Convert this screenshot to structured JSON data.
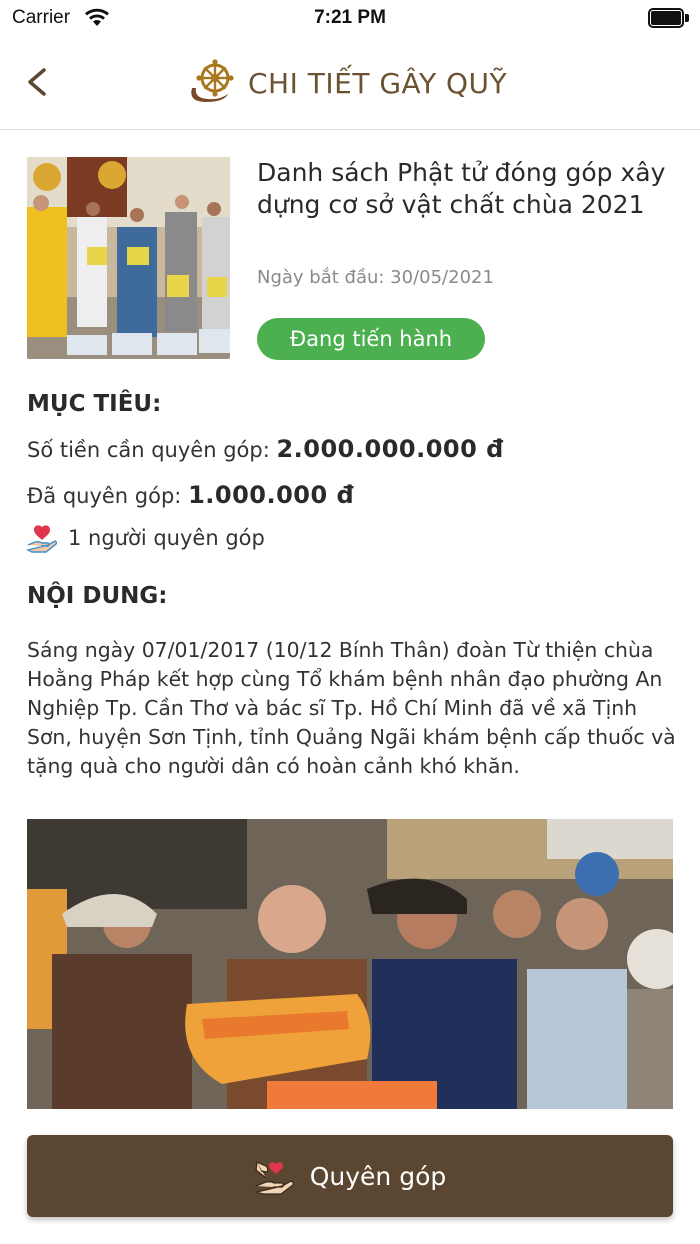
{
  "status_bar": {
    "carrier": "Carrier",
    "time": "7:21 PM"
  },
  "nav": {
    "title": "CHI TIẾT GÂY QUỸ",
    "back_icon": "chevron-left-icon",
    "logo_icon": "dharma-wheel-icon"
  },
  "campaign": {
    "title": "Danh sách Phật tử đóng góp xây dựng cơ sở vật chất chùa 2021",
    "start_date": "Ngày bắt đầu: 30/05/2021",
    "status": "Đang tiến hành"
  },
  "goal": {
    "heading": "MỤC TIÊU:",
    "target_label": "Số tiền cần quyên góp: ",
    "target_value": "2.000.000.000 đ",
    "raised_label": "Đã quyên góp: ",
    "raised_value": "1.000.000 đ",
    "donors": "1 người quyên góp"
  },
  "content": {
    "heading": "NỘI DUNG:",
    "text": "Sáng ngày 07/01/2017 (10/12 Bính Thân) đoàn Từ thiện chùa Hoằng Pháp kết hợp cùng Tổ khám bệnh nhân đạo phường An Nghiệp Tp. Cần Thơ và bác sĩ Tp. Hồ Chí Minh đã về xã Tịnh Sơn, huyện Sơn Tịnh, tỉnh Quảng Ngãi khám bệnh cấp thuốc và tặng quà cho người dân có hoàn cảnh khó khăn."
  },
  "donate_button": {
    "label": "Quyên góp"
  },
  "colors": {
    "accent": "#5a4631",
    "status_green": "#4caf50",
    "title_brown": "#6b5232"
  }
}
